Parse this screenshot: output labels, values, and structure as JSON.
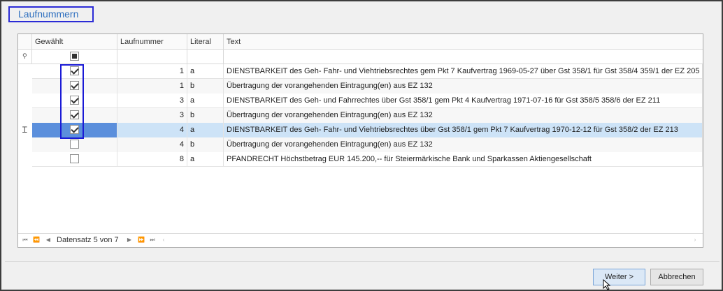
{
  "dialog": {
    "title": "Laufnummern"
  },
  "grid": {
    "columns": [
      "Gewählt",
      "Laufnummer",
      "Literal",
      "Text"
    ],
    "rows": [
      {
        "checked": true,
        "laufnummer": "1",
        "literal": "a",
        "text": "DIENSTBARKEIT des Geh- Fahr- und Viehtriebsrechtes gem Pkt 7 Kaufvertrag 1969-05-27 über Gst 358/1 für Gst 358/4 359/1 der EZ 205"
      },
      {
        "checked": true,
        "laufnummer": "1",
        "literal": "b",
        "text": "Übertragung der vorangehenden Eintragung(en) aus EZ 132"
      },
      {
        "checked": true,
        "laufnummer": "3",
        "literal": "a",
        "text": "DIENSTBARKEIT des Geh- und Fahrrechtes über Gst 358/1 gem Pkt 4 Kaufvertrag 1971-07-16 für Gst 358/5 358/6 der EZ 211"
      },
      {
        "checked": true,
        "laufnummer": "3",
        "literal": "b",
        "text": "Übertragung der vorangehenden Eintragung(en) aus EZ 132"
      },
      {
        "checked": true,
        "laufnummer": "4",
        "literal": "a",
        "text": "DIENSTBARKEIT des Geh- Fahr- und Viehtriebsrechtes über Gst 358/1 gem Pkt 7 Kaufvertrag 1970-12-12 für Gst 358/2 der EZ 213"
      },
      {
        "checked": false,
        "laufnummer": "4",
        "literal": "b",
        "text": "Übertragung der vorangehenden Eintragung(en) aus EZ 132"
      },
      {
        "checked": false,
        "laufnummer": "8",
        "literal": "a",
        "text": "PFANDRECHT Höchstbetrag EUR 145.200,-- für Steiermärkische Bank und Sparkassen Aktiengesellschaft"
      }
    ],
    "navigator": {
      "record_text": "Datensatz 5 von 7"
    }
  },
  "buttons": {
    "next": "Weiter >",
    "cancel": "Abbrechen"
  },
  "colors": {
    "accent": "#2b2bd6",
    "selection": "#5b8fdc",
    "row_highlight": "#cde3f7"
  }
}
